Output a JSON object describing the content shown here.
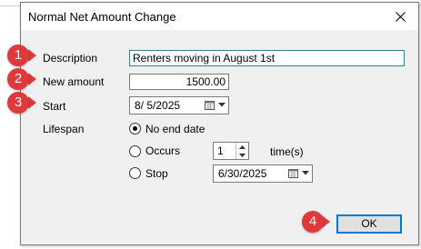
{
  "dialog": {
    "title": "Normal Net Amount Change",
    "close_icon": "close-icon"
  },
  "form": {
    "description_label": "Description",
    "description_value": "Renters moving in August 1st",
    "new_amount_label": "New amount",
    "new_amount_value": "1500.00",
    "start_label": "Start",
    "start_value": "8/ 5/2025",
    "lifespan_label": "Lifespan",
    "no_end_date_label": "No end date",
    "occurs_label": "Occurs",
    "occurs_value": "1",
    "times_label": "time(s)",
    "stop_label": "Stop",
    "stop_value": "6/30/2025",
    "lifespan_selected": "No end date"
  },
  "ok_label": "OK",
  "callouts": [
    "1",
    "2",
    "3",
    "4"
  ],
  "colors": {
    "callout": "#e0393b",
    "focus_border": "#0078d7",
    "dialog_bg": "#f0f0f0"
  }
}
